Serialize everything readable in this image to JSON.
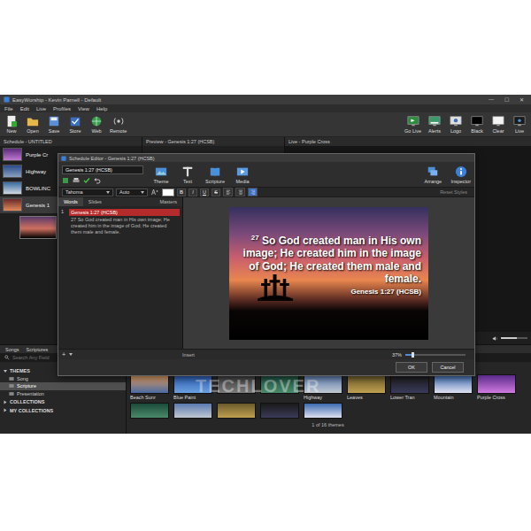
{
  "window": {
    "title": "EasyWorship - Kevin Parnell - Default",
    "controls": [
      "—",
      "☐",
      "✕"
    ]
  },
  "menu": [
    "File",
    "Edit",
    "Live",
    "Profiles",
    "View",
    "Help"
  ],
  "toolbar": {
    "left": [
      "New",
      "Open",
      "Save",
      "Store",
      "Web",
      "Remote"
    ],
    "right": [
      "Go Live",
      "Alerts",
      "Logo",
      "Black",
      "Clear",
      "Live"
    ]
  },
  "panels": {
    "schedule": "Schedule - UNTITLED",
    "preview": "Preview - Genesis 1:27 (HCSB)",
    "live": "Live - Purple Cross"
  },
  "schedule": {
    "items": [
      {
        "title": "Purple Cr",
        "selected": false
      },
      {
        "title": "Highway",
        "selected": false
      },
      {
        "title": "BOWLINC",
        "selected": false
      },
      {
        "title": "Genesis 1",
        "selected": true
      }
    ]
  },
  "live": {
    "volume": {
      "level": 0.6
    }
  },
  "dialog": {
    "title": "Schedule Editor - Genesis 1:27 (HCSB)",
    "name_field": "Genesis 1:27 (HCSB)",
    "tools": [
      "Theme",
      "Text",
      "Scripture",
      "Media"
    ],
    "tools_right": [
      "Arrange",
      "Inspector"
    ],
    "format": {
      "font": "Tahoma",
      "size": "Auto",
      "styles": [
        {
          "label": "B",
          "on": false
        },
        {
          "label": "I",
          "on": false
        },
        {
          "label": "U",
          "on": false
        },
        {
          "label": "S",
          "on": false
        }
      ],
      "align": [
        {
          "selected": false
        },
        {
          "selected": false
        },
        {
          "selected": true
        }
      ],
      "reset": "Reset Styles"
    },
    "tabs": [
      {
        "label": "Words",
        "selected": true
      },
      {
        "label": "Slides",
        "selected": false
      },
      {
        "label": "Masters",
        "selected": false
      }
    ],
    "slides": [
      {
        "number": "1",
        "title": "Genesis 1:27 (HCSB)",
        "text": "27 So God created man in His own image; He created him in the image of God; He created them male and female.",
        "selected": true
      }
    ],
    "canvas": {
      "verse_number": "27",
      "verse": "So God created man in His own image; He created him in the image of God; He created them male and female.",
      "reference": "Genesis 1:27 (HCSB)"
    },
    "add": "+",
    "insert": "Insert",
    "zoom": {
      "reading": "37%",
      "level": 0.12
    },
    "buttons": [
      "OK",
      "Cancel"
    ]
  },
  "library": {
    "tabs": [
      {
        "label": "Songs",
        "selected": false
      },
      {
        "label": "Scriptures",
        "selected": false
      }
    ],
    "search": {
      "placeholder": "Search Any Field"
    },
    "sidebar": [
      {
        "label": "THEMES",
        "kind": "header",
        "expanded": true,
        "selected": false
      },
      {
        "label": "Song",
        "kind": "item",
        "selected": false
      },
      {
        "label": "Scripture",
        "kind": "item",
        "selected": true
      },
      {
        "label": "Presentation",
        "kind": "item",
        "selected": false
      },
      {
        "label": "COLLECTIONS",
        "kind": "header",
        "expanded": false,
        "selected": false
      },
      {
        "label": "MY COLLECTIONS",
        "kind": "header",
        "expanded": false,
        "selected": false
      }
    ],
    "themes": [
      {
        "label": "Beach Sunr"
      },
      {
        "label": "Blue Paint"
      },
      {
        "label": ""
      },
      {
        "label": ""
      },
      {
        "label": "Highway"
      },
      {
        "label": "Leaves"
      },
      {
        "label": "Lower Tran"
      },
      {
        "label": "Mountain"
      },
      {
        "label": "Purple Cross"
      }
    ],
    "count": "1 of 16 themes"
  },
  "watermark": "TECHLOVER"
}
